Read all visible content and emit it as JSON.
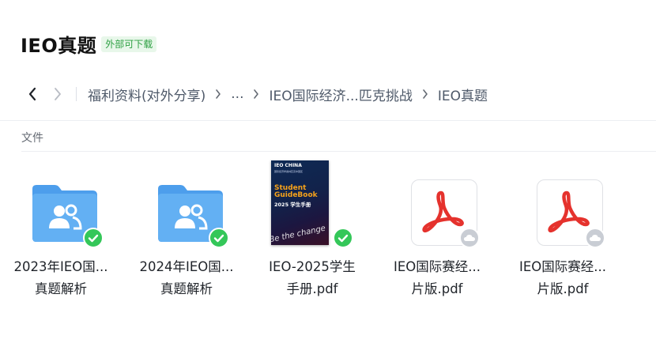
{
  "header": {
    "title": "IEO真题",
    "badge": "外部可下载"
  },
  "breadcrumb": {
    "items": [
      "福利资料(对外分享)",
      "...",
      "IEO国际经济...匹克挑战",
      "IEO真题"
    ]
  },
  "section": {
    "label": "文件"
  },
  "files": [
    {
      "type": "shared-folder",
      "line1": "2023年IEO国...",
      "line2": "真题解析",
      "status": "synced"
    },
    {
      "type": "shared-folder",
      "line1": "2024年IEO国...",
      "line2": "真题解析",
      "status": "synced"
    },
    {
      "type": "pdf-cover",
      "line1": "IEO-2025学生",
      "line2": "手册.pdf",
      "status": "synced",
      "cover": {
        "brand": "IEO CHINA",
        "subtitle": "国际经济学奥林匹克中国区",
        "heading_1": "Student",
        "heading_2": "GuideBook",
        "heading_3": "2025 学生手册",
        "script": "Be the change"
      }
    },
    {
      "type": "pdf",
      "line1": "IEO国际赛经...",
      "line2": "片版.pdf",
      "status": "cloud"
    },
    {
      "type": "pdf",
      "line1": "IEO国际赛经...",
      "line2": "片版.pdf",
      "status": "cloud"
    }
  ],
  "colors": {
    "folder": "#5aa8f0",
    "pdf_red": "#e5322d",
    "badge_green": "#2ea043",
    "status_green": "#34c759",
    "status_cloud": "#c9cdd4"
  }
}
